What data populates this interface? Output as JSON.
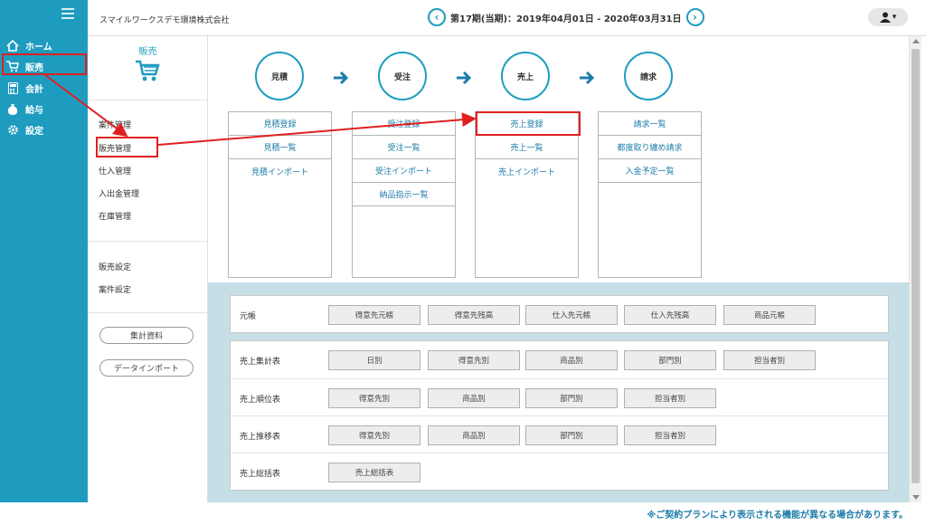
{
  "header": {
    "company": "スマイルワークスデモ環境株式会社",
    "period": "第17期(当期)：2019年04月01日 - 2020年03月31日",
    "prev": "‹",
    "next": "›",
    "user_icon": "▾"
  },
  "nav": {
    "items": [
      {
        "label": "ホーム",
        "icon": "home-icon"
      },
      {
        "label": "販売",
        "icon": "cart-icon"
      },
      {
        "label": "会計",
        "icon": "calculator-icon"
      },
      {
        "label": "給与",
        "icon": "moneybag-icon"
      },
      {
        "label": "設定",
        "icon": "gear-icon"
      }
    ]
  },
  "sub": {
    "title": "販売",
    "items": [
      "案件管理",
      "販売管理",
      "仕入管理",
      "入出金管理",
      "在庫管理"
    ],
    "items2": [
      "販売設定",
      "案件設定"
    ],
    "buttons": [
      "集計資料",
      "データインポート"
    ]
  },
  "flow": {
    "steps": [
      "見積",
      "受注",
      "売上",
      "請求"
    ],
    "columns": [
      [
        "見積登録",
        "見積一覧",
        "見積インポート"
      ],
      [
        "受注登録",
        "受注一覧",
        "受注インポート",
        "納品指示一覧"
      ],
      [
        "売上登録",
        "売上一覧",
        "売上インポート"
      ],
      [
        "請求一覧",
        "都度取り纏め請求",
        "入金予定一覧"
      ]
    ]
  },
  "reports": {
    "ledger": {
      "label": "元帳",
      "buttons": [
        "得意先元帳",
        "得意先残高",
        "仕入先元帳",
        "仕入先残高",
        "商品元帳"
      ]
    },
    "rows": [
      {
        "label": "売上集計表",
        "buttons": [
          "日別",
          "得意先別",
          "商品別",
          "部門別",
          "担当者別"
        ]
      },
      {
        "label": "売上順位表",
        "buttons": [
          "得意先別",
          "商品別",
          "部門別",
          "担当者別"
        ]
      },
      {
        "label": "売上推移表",
        "buttons": [
          "得意先別",
          "商品別",
          "部門別",
          "担当者別"
        ]
      },
      {
        "label": "売上総括表",
        "buttons": [
          "売上総括表"
        ]
      }
    ]
  },
  "footer": "※ご契約プランにより表示される機能が異なる場合があります。",
  "colors": {
    "accent": "#1e9cc0",
    "highlight": "#e02020"
  }
}
